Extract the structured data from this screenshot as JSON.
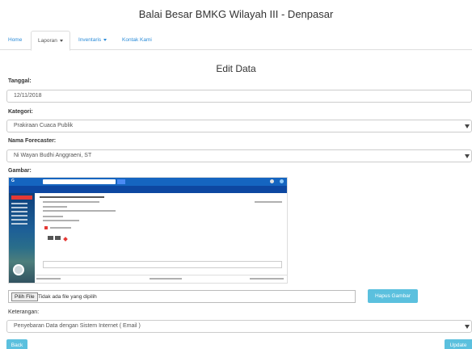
{
  "site": {
    "title": "Balai Besar BMKG Wilayah III - Denpasar"
  },
  "nav": {
    "items": [
      {
        "label": "Home"
      },
      {
        "label": "Laporan"
      },
      {
        "label": "Inventaris"
      },
      {
        "label": "Kontak Kami"
      }
    ]
  },
  "page": {
    "heading": "Edit Data"
  },
  "form": {
    "tanggal": {
      "label": "Tanggal:",
      "value": "12/11/2018"
    },
    "kategori": {
      "label": "Kategori:",
      "value": "Prakiraan Cuaca Publik"
    },
    "forecaster": {
      "label": "Nama Forecaster:",
      "value": "Ni Wayan Budhi Anggraeni, ST"
    },
    "gambar": {
      "label": "Gambar:",
      "file_button": "Pilih File",
      "file_status": "Tidak ada file yang dipilih",
      "delete_button": "Hapus Gambar"
    },
    "keterangan": {
      "label": "Keterangan:",
      "value": "Penyebaran Data dengan Sistem Internet ( Email )"
    }
  },
  "actions": {
    "back": "Back",
    "update": "Update"
  },
  "colors": {
    "accent": "#5bc0de",
    "link": "#2a8bd8"
  }
}
